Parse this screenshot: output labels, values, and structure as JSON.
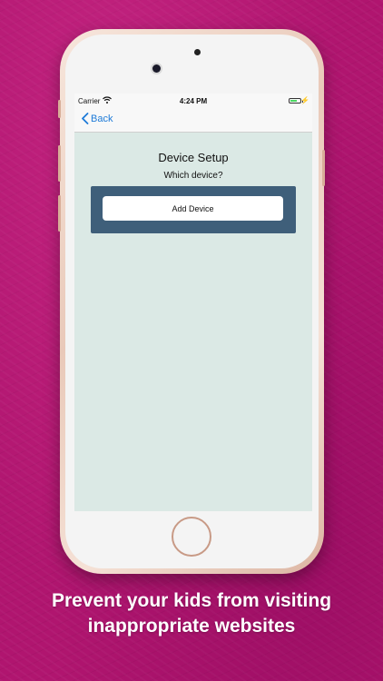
{
  "status_bar": {
    "carrier": "Carrier",
    "time": "4:24 PM",
    "battery_level": 0.7
  },
  "nav": {
    "back_label": "Back"
  },
  "content": {
    "title": "Device Setup",
    "subtitle": "Which device?",
    "add_device_label": "Add Device"
  },
  "caption": {
    "line1": "Prevent your kids from visiting",
    "line2": "inappropriate websites"
  },
  "colors": {
    "background": "#b0156f",
    "screen": "#dbe9e5",
    "panel": "#3f5f7a",
    "accent": "#1e7bd8"
  }
}
